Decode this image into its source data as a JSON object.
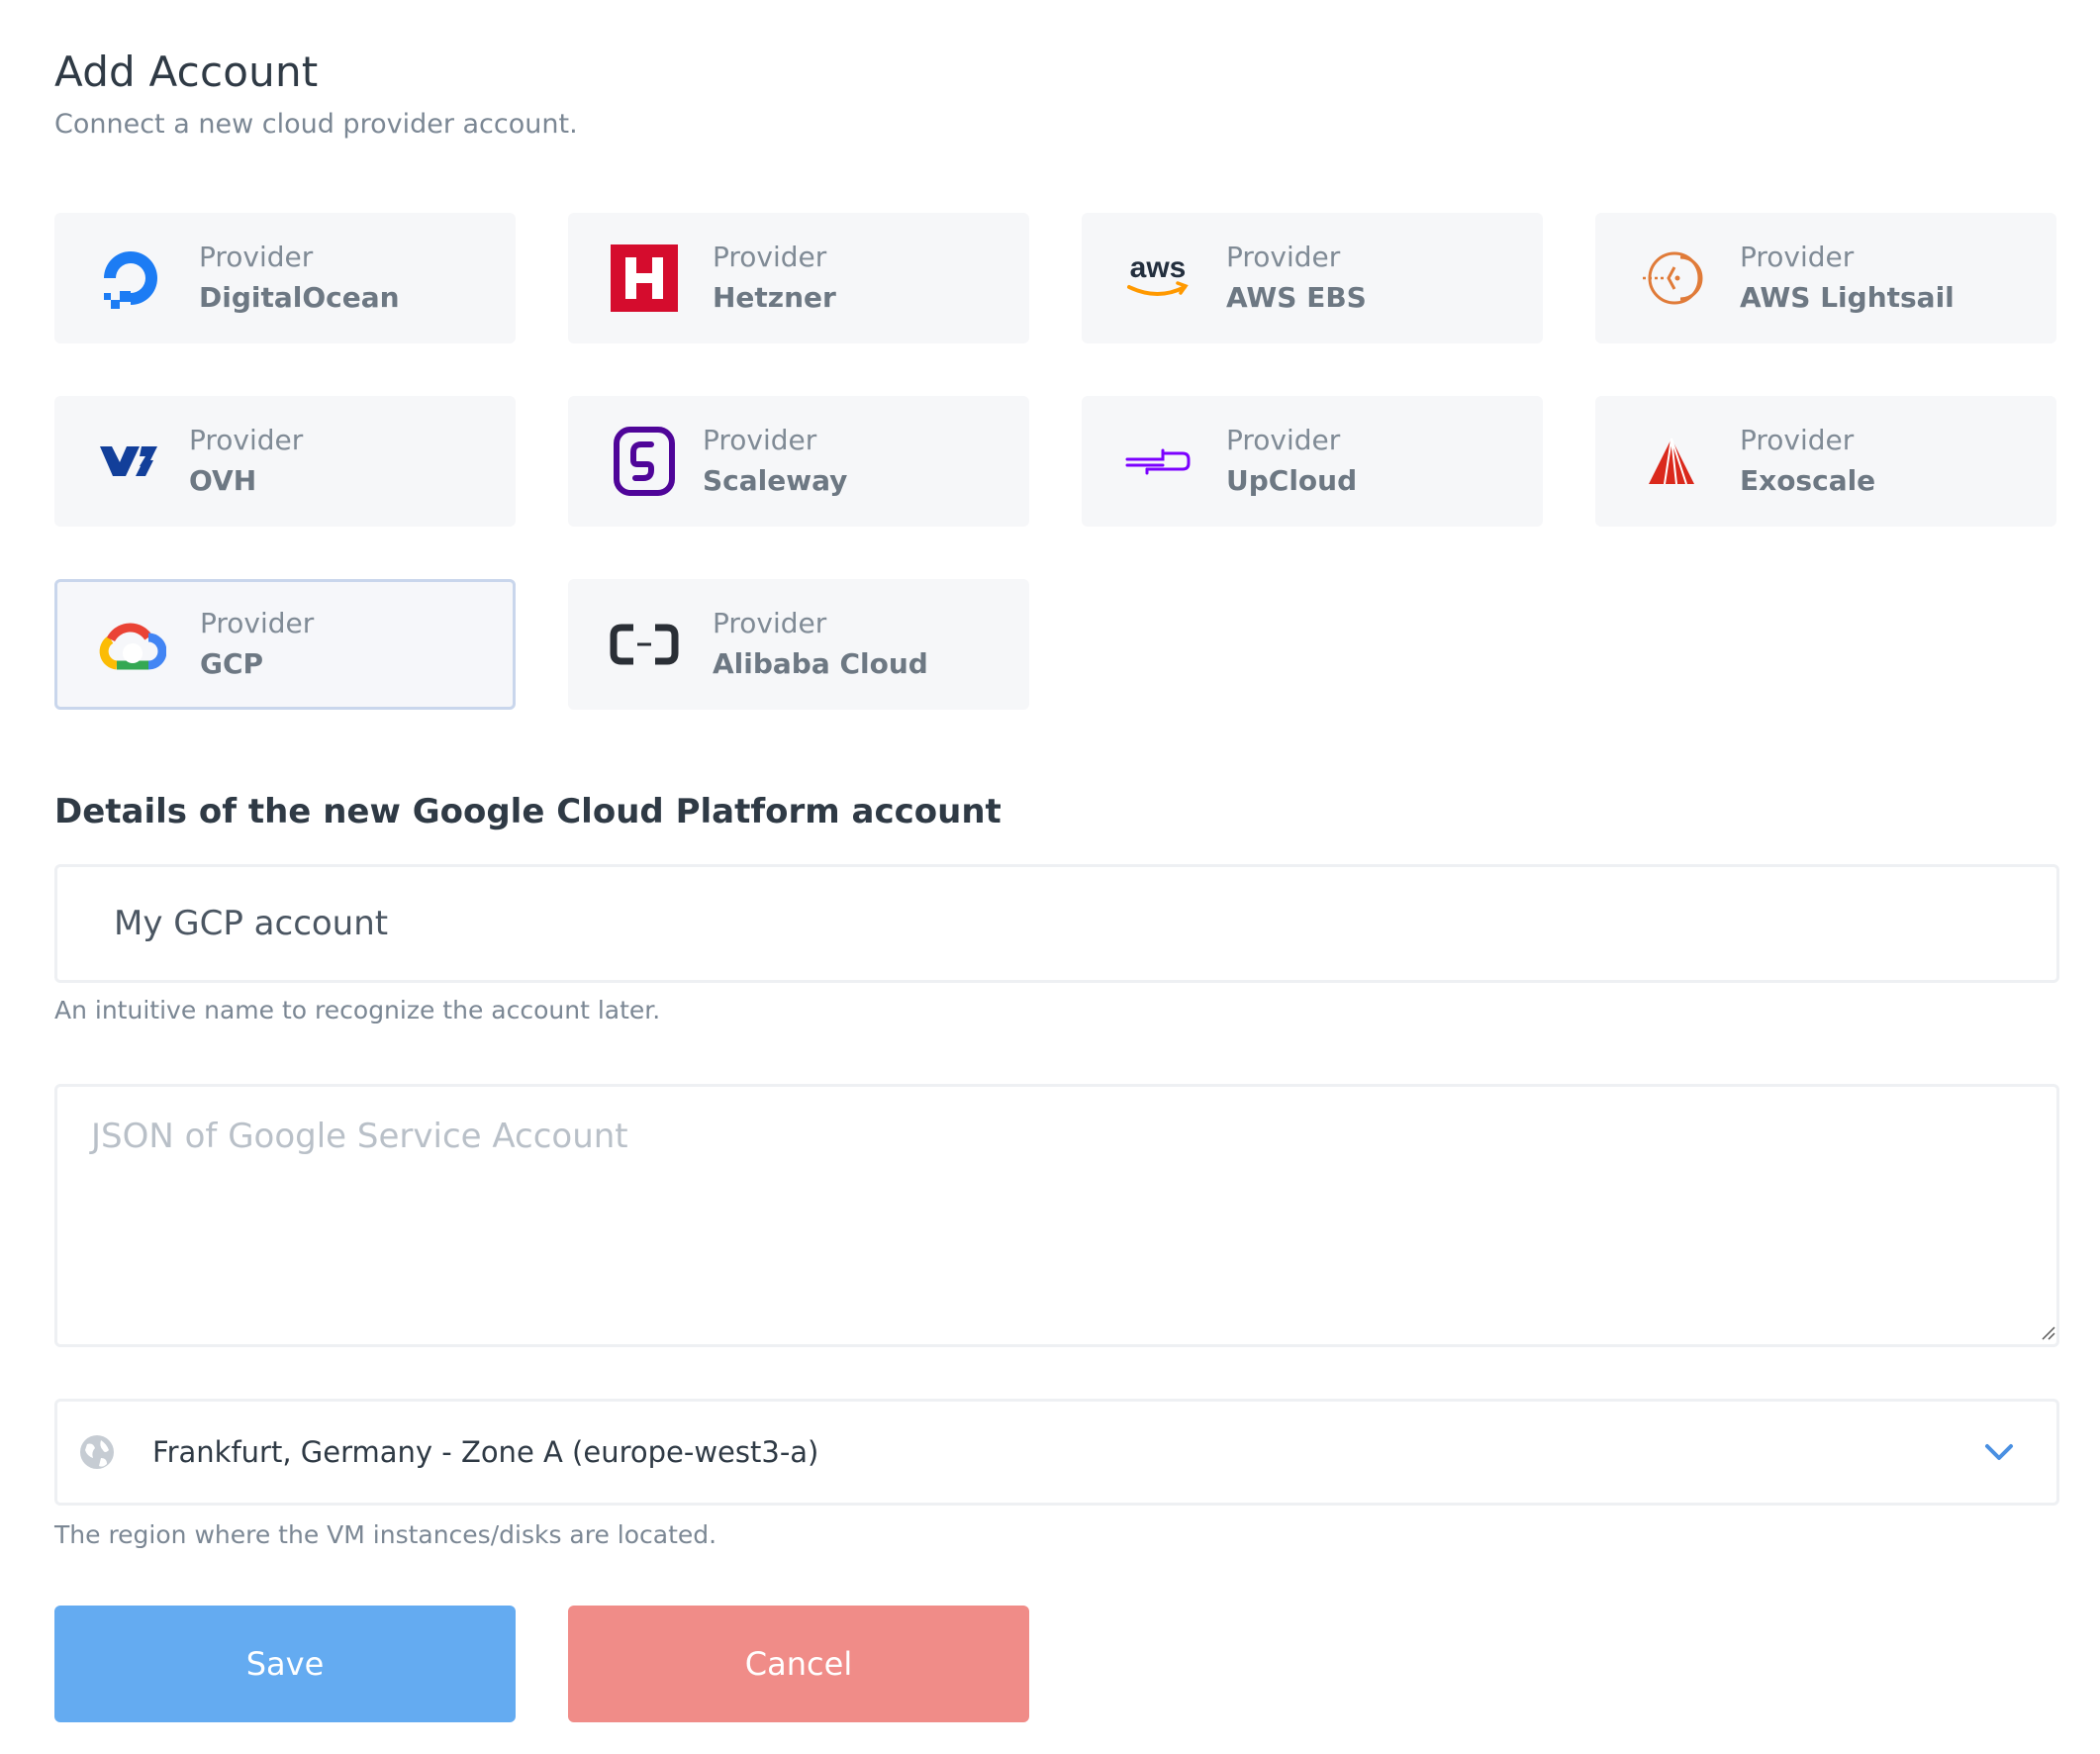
{
  "header": {
    "title": "Add Account",
    "subtitle": "Connect a new cloud provider account."
  },
  "providers": [
    {
      "kicker": "Provider",
      "name": "DigitalOcean",
      "icon": "digitalocean-icon",
      "selected": false
    },
    {
      "kicker": "Provider",
      "name": "Hetzner",
      "icon": "hetzner-icon",
      "selected": false
    },
    {
      "kicker": "Provider",
      "name": "AWS EBS",
      "icon": "aws-icon",
      "selected": false
    },
    {
      "kicker": "Provider",
      "name": "AWS Lightsail",
      "icon": "aws-lightsail-icon",
      "selected": false
    },
    {
      "kicker": "Provider",
      "name": "OVH",
      "icon": "ovh-icon",
      "selected": false
    },
    {
      "kicker": "Provider",
      "name": "Scaleway",
      "icon": "scaleway-icon",
      "selected": false
    },
    {
      "kicker": "Provider",
      "name": "UpCloud",
      "icon": "upcloud-icon",
      "selected": false
    },
    {
      "kicker": "Provider",
      "name": "Exoscale",
      "icon": "exoscale-icon",
      "selected": false
    },
    {
      "kicker": "Provider",
      "name": "GCP",
      "icon": "gcp-icon",
      "selected": true
    },
    {
      "kicker": "Provider",
      "name": "Alibaba Cloud",
      "icon": "alibaba-cloud-icon",
      "selected": false
    }
  ],
  "form": {
    "section_title": "Details of the new Google Cloud Platform account",
    "name_value": "My GCP account",
    "name_hint": "An intuitive name to recognize the account later.",
    "json_placeholder": "JSON of Google Service Account",
    "region_value": "Frankfurt, Germany - Zone A (europe-west3-a)",
    "region_hint": "The region where the VM instances/disks are located."
  },
  "actions": {
    "save_label": "Save",
    "cancel_label": "Cancel"
  },
  "colors": {
    "save": "#64abf1",
    "cancel": "#f08c88",
    "selected_border": "#c9d6ec",
    "accent_chevron": "#4a90e2"
  }
}
